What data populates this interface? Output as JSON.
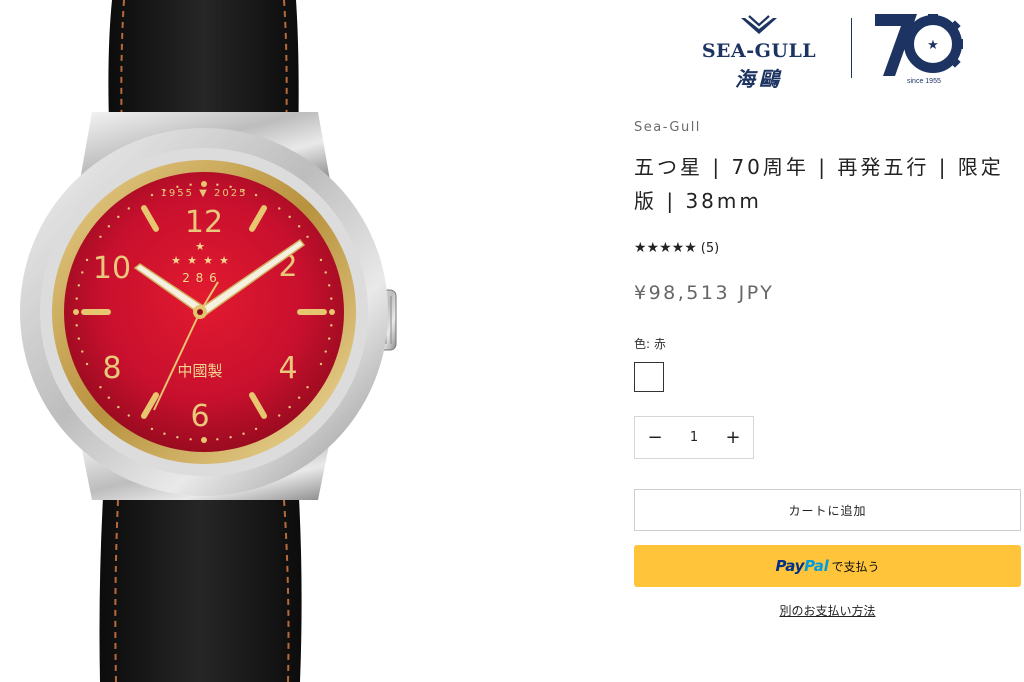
{
  "brand": {
    "wordmark": "SEA-GULL",
    "wordmark_cjk": "海鷗",
    "anniversary_number": "70",
    "anniversary_since": "since 1955",
    "navy": "#1d3361"
  },
  "watch_image": {
    "dial_color": "#c8102e",
    "strap_color": "#161616",
    "dial_text_years": "1955 ▼ 2025",
    "dial_calibre": "2 8 6",
    "dial_origin": "中國製",
    "numerals": [
      "12",
      "2",
      "4",
      "6",
      "8",
      "10"
    ]
  },
  "product": {
    "vendor": "Sea-Gull",
    "title": "五つ星 | 70周年 | 再発五行 | 限定版 | 38mm",
    "rating_stars": "★★★★★",
    "rating_value": 5,
    "rating_count": "(5)",
    "price": "¥98,513 JPY",
    "color_label": "色: 赤",
    "quantity": {
      "decrement": "−",
      "value": "1",
      "increment": "+"
    },
    "add_to_cart": "カートに追加",
    "paypal_pay": "Pay",
    "paypal_pal": "Pal",
    "paypal_suffix": "で支払う",
    "more_payment_options": "別のお支払い方法"
  }
}
